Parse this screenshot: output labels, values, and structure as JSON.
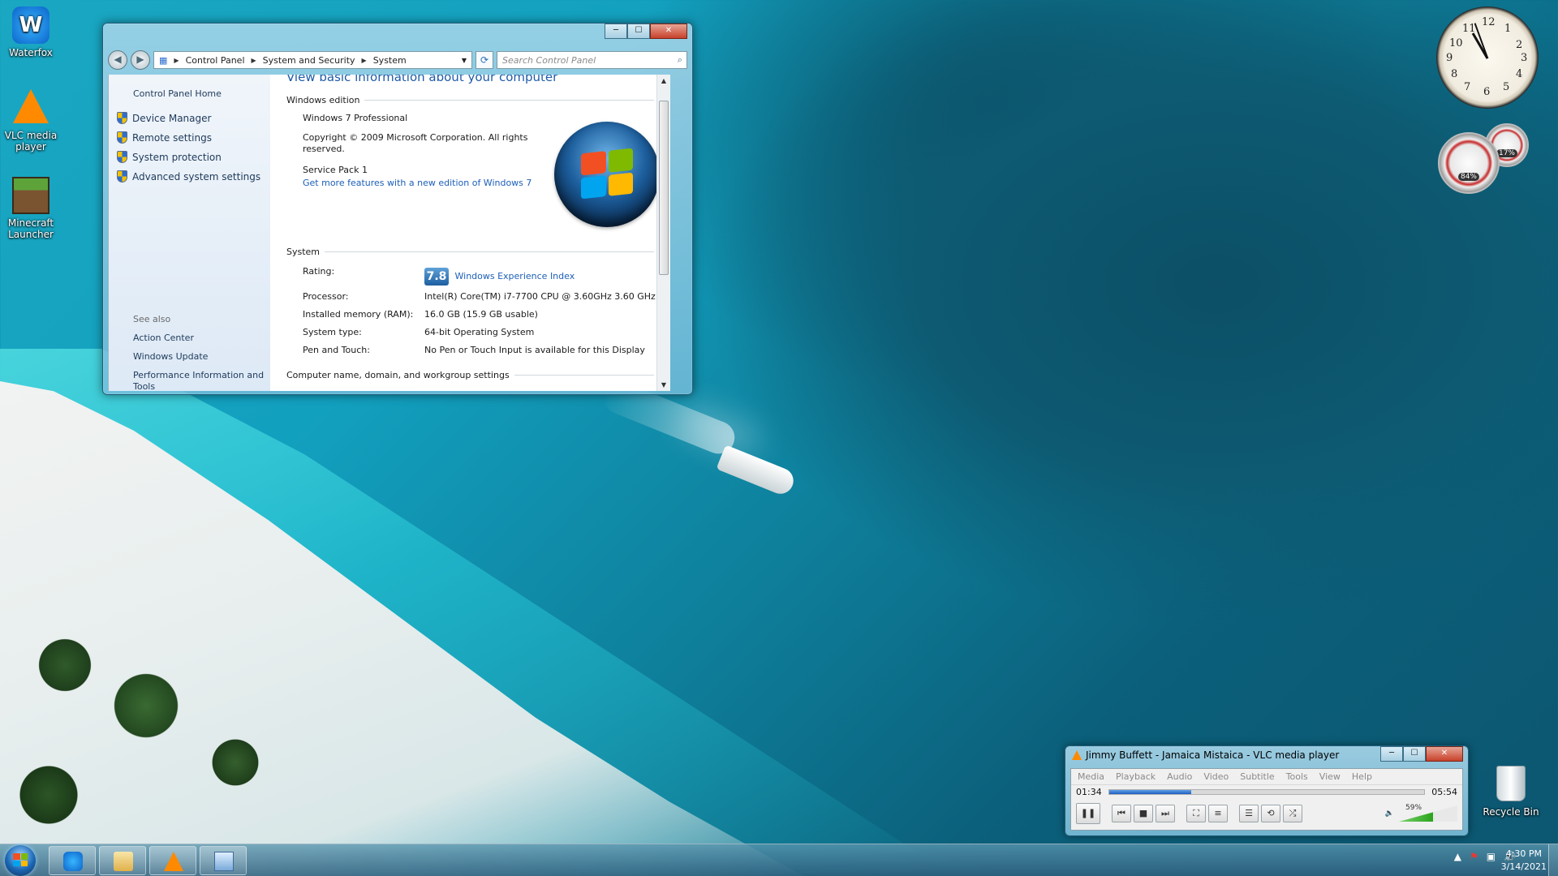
{
  "desktop": {
    "icons": [
      {
        "label": "Waterfox",
        "icon": "waterfox-icon"
      },
      {
        "label": "VLC media player",
        "icon": "vlc-icon"
      },
      {
        "label": "Minecraft Launcher",
        "icon": "minecraft-icon"
      },
      {
        "label": "Recycle Bin",
        "icon": "recycle-bin-icon"
      }
    ]
  },
  "gadgets": {
    "clock_numbers": [
      "12",
      "1",
      "2",
      "3",
      "4",
      "5",
      "6",
      "7",
      "8",
      "9",
      "10",
      "11"
    ],
    "cpu_meter": {
      "cpu_percent": "84%",
      "mem_percent": "17%"
    }
  },
  "explorer": {
    "controls": {
      "minimize": "─",
      "maximize": "☐",
      "close": "✕"
    },
    "breadcrumb": [
      "Control Panel",
      "System and Security",
      "System"
    ],
    "search_placeholder": "Search Control Panel",
    "left_pane": {
      "home": "Control Panel Home",
      "tasks": [
        "Device Manager",
        "Remote settings",
        "System protection",
        "Advanced system settings"
      ],
      "see_also_label": "See also",
      "see_also": [
        "Action Center",
        "Windows Update",
        "Performance Information and Tools"
      ]
    },
    "content": {
      "heading": "View basic information about your computer",
      "windows_edition_header": "Windows edition",
      "edition": "Windows 7 Professional",
      "copyright": "Copyright © 2009 Microsoft Corporation.  All rights reserved.",
      "service_pack": "Service Pack 1",
      "more_features_link": "Get more features with a new edition of Windows 7",
      "system_header": "System",
      "rows": [
        {
          "label": "Rating:",
          "value": ""
        },
        {
          "label": "Processor:",
          "value": "Intel(R) Core(TM) i7-7700 CPU @ 3.60GHz   3.60 GHz"
        },
        {
          "label": "Installed memory (RAM):",
          "value": "16.0 GB (15.9 GB usable)"
        },
        {
          "label": "System type:",
          "value": "64-bit Operating System"
        },
        {
          "label": "Pen and Touch:",
          "value": "No Pen or Touch Input is available for this Display"
        }
      ],
      "rating_score": "7.8",
      "rating_link": "Windows Experience Index",
      "computer_name_header": "Computer name, domain, and workgroup settings"
    }
  },
  "vlc": {
    "title": "Jimmy Buffett - Jamaica Mistaica - VLC media player",
    "menu": [
      "Media",
      "Playback",
      "Audio",
      "Video",
      "Subtitle",
      "Tools",
      "View",
      "Help"
    ],
    "elapsed": "01:34",
    "duration": "05:54",
    "progress_fraction": 0.26,
    "volume": "59%",
    "volume_fraction": 0.59
  },
  "taskbar": {
    "time": "4:30 PM",
    "date": "3/14/2021",
    "items": [
      "Waterfox",
      "Windows Explorer",
      "VLC media player",
      "Control Panel"
    ]
  }
}
